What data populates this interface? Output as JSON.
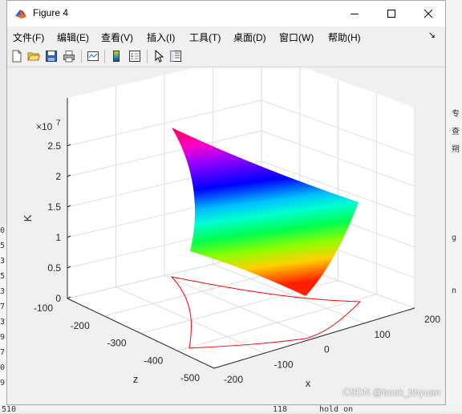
{
  "window": {
    "title": "Figure 4"
  },
  "menu": [
    {
      "label": "文件(F)"
    },
    {
      "label": "编辑(E)"
    },
    {
      "label": "查看(V)"
    },
    {
      "label": "插入(I)"
    },
    {
      "label": "工具(T)"
    },
    {
      "label": "桌面(D)"
    },
    {
      "label": "窗口(W)"
    },
    {
      "label": "帮助(H)"
    }
  ],
  "toolbar": [
    "new-figure-icon",
    "open-folder-icon",
    "save-icon",
    "print-icon",
    "link-plot-icon",
    "colorbar-icon",
    "legend-icon",
    "pointer-icon",
    "property-editor-icon"
  ],
  "plot": {
    "exponent_label": "×10",
    "exponent_power": "7",
    "zlabel": "K",
    "xlabel": "x",
    "ylabel": "z",
    "z_ticks": [
      "0",
      "0.5",
      "1",
      "1.5",
      "2",
      "2.5"
    ],
    "x_ticks": [
      "-200",
      "-100",
      "0",
      "100",
      "200"
    ],
    "y_ticks": [
      "-100",
      "-200",
      "-300",
      "-400",
      "-500"
    ]
  },
  "chart_data": {
    "type": "surface",
    "zlabel": "K",
    "xlabel": "x",
    "ylabel": "z",
    "xlim": [
      -200,
      200
    ],
    "ylim": [
      -500,
      -100
    ],
    "zlim": [
      0,
      25000000
    ],
    "z_scale_exponent": 7,
    "grid": true,
    "surface_colormap": "hsv",
    "projection_color": "#ff0000"
  },
  "background": {
    "left_glyphs": [
      "0",
      "5",
      "3",
      "5",
      "3",
      "7",
      "3",
      "9",
      "7",
      "0",
      "9"
    ],
    "right_glyphs": [
      "专",
      "查",
      "朔",
      "",
      "",
      "",
      "",
      "g",
      "",
      "",
      "n"
    ],
    "bottom_left_text": "510",
    "bottom_mid_text": "118",
    "bottom_right_text": "hold on"
  },
  "watermark": "CSDN @book_bbyuan"
}
